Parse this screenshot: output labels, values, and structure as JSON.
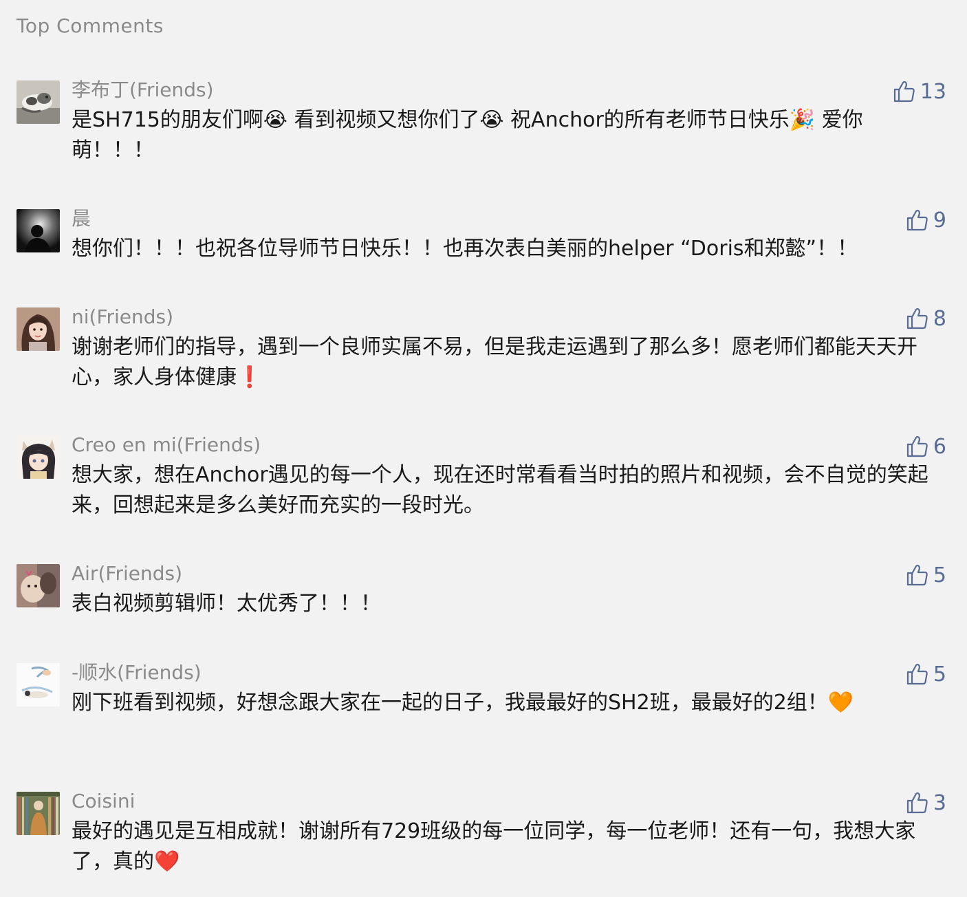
{
  "section": {
    "title": "Top Comments"
  },
  "colors": {
    "background": "#f2f2f2",
    "name": "#8a8a8a",
    "text": "#1a1a1a",
    "like": "#576b95"
  },
  "comments": [
    {
      "avatar_icon": "cat-avatar-icon",
      "name": "李布丁(Friends)",
      "likes": "13",
      "text": "是SH715的朋友们啊😭 看到视频又想你们了😭 祝Anchor的所有老师节日快乐🎉 爱你萌！！！"
    },
    {
      "avatar_icon": "silhouette-avatar-icon",
      "name": "晨",
      "likes": "9",
      "text": "想你们！！！也祝各位导师节日快乐！！也再次表白美丽的helper “Doris和郑懿”！！"
    },
    {
      "avatar_icon": "girl-portrait-avatar-icon",
      "name": "ni(Friends)",
      "likes": "8",
      "text": "谢谢老师们的指导，遇到一个良师实属不易，但是我走运遇到了那么多！愿老师们都能天天开心，家人身体健康❗"
    },
    {
      "avatar_icon": "anime-cat-girl-avatar-icon",
      "name": "Creo en mi(Friends)",
      "likes": "6",
      "text": "想大家，想在Anchor遇见的每一个人，现在还时常看看当时拍的照片和视频，会不自觉的笑起来，回想起来是多么美好而充实的一段时光。"
    },
    {
      "avatar_icon": "puppy-avatar-icon",
      "name": "Air(Friends)",
      "likes": "5",
      "text": "表白视频剪辑师！太优秀了！！！"
    },
    {
      "avatar_icon": "sketch-cats-avatar-icon",
      "name": "-顺水(Friends)",
      "likes": "5",
      "text": "刚下班看到视频，好想念跟大家在一起的日子，我最最好的SH2班，最最好的2组！🧡"
    },
    {
      "avatar_icon": "bookshelf-avatar-icon",
      "name": "Coisini",
      "likes": "3",
      "text": "最好的遇见是互相成就！谢谢所有729班级的每一位同学，每一位老师！还有一句，我想大家了，真的❤️"
    }
  ]
}
